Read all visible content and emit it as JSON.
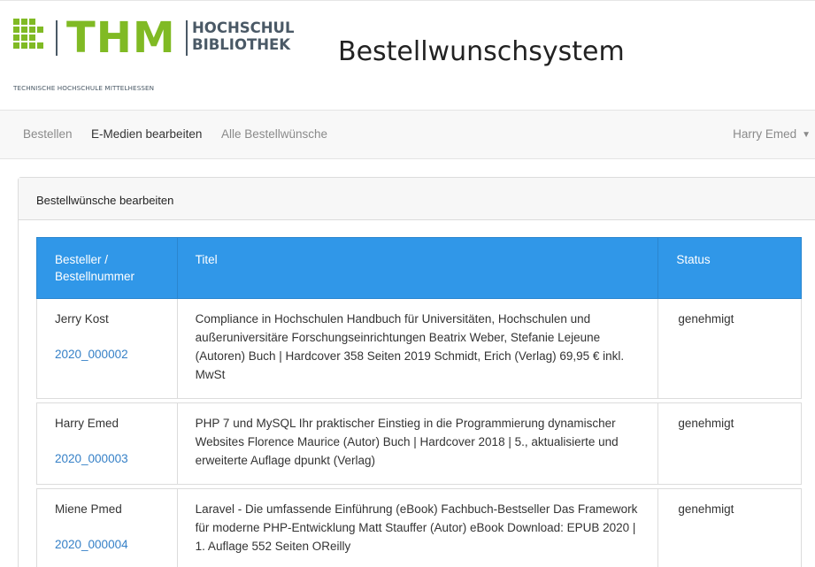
{
  "header": {
    "logo_main": "THM",
    "logo_subtitle": "TECHNISCHE HOCHSCHULE MITTELHESSEN",
    "logo_library_line1": "HOCHSCHUL",
    "logo_library_line2": "BIBLIOTHEK",
    "app_title": "Bestellwunschsystem"
  },
  "nav": {
    "items": [
      {
        "label": "Bestellen"
      },
      {
        "label": "E-Medien bearbeiten",
        "active": true
      },
      {
        "label": "Alle Bestellwünsche"
      }
    ],
    "user": "Harry Emed",
    "user_icon": "caret-down-icon"
  },
  "card": {
    "title": "Bestellwünsche bearbeiten"
  },
  "table": {
    "headers": [
      "Besteller / Bestellnummer",
      "Titel",
      "Status"
    ],
    "rows": [
      {
        "besteller": "Jerry Kost",
        "nummer": "2020_000002",
        "titel": "Compliance in Hochschulen Handbuch für Universitäten, Hochschulen und außeruniversitäre Forschungseinrichtungen Beatrix Weber, Stefanie Lejeune (Autoren) Buch | Hardcover 358 Seiten 2019 Schmidt, Erich (Verlag) 69,95 € inkl. MwSt",
        "status": "genehmigt"
      },
      {
        "besteller": "Harry Emed",
        "nummer": "2020_000003",
        "titel": "PHP 7 und MySQL Ihr praktischer Einstieg in die Programmierung dynamischer Websites Florence Maurice (Autor) Buch | Hardcover 2018 | 5., aktualisierte und erweiterte Auflage dpunkt (Verlag)",
        "status": "genehmigt"
      },
      {
        "besteller": "Miene Pmed",
        "nummer": "2020_000004",
        "titel": "Laravel - Die umfassende Einführung (eBook) Fachbuch-Bestseller Das Framework für moderne PHP-Entwicklung Matt Stauffer (Autor) eBook Download: EPUB 2020 | 1. Auflage 552 Seiten OReilly",
        "status": "genehmigt"
      }
    ]
  },
  "colors": {
    "brand_green": "#80ba24",
    "brand_gray": "#4a5966",
    "table_header": "#3097e8",
    "link": "#3580c7"
  }
}
